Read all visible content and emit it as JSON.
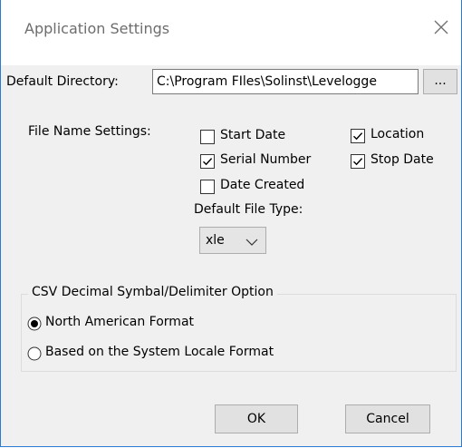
{
  "window": {
    "title": "Application Settings"
  },
  "directory": {
    "label": "Default Directory:",
    "value": "C:\\Program FIles\\Solinst\\Levelogge",
    "browse_label": "..."
  },
  "file_name_settings": {
    "label": "File Name Settings:",
    "options": [
      {
        "label": "Start Date",
        "checked": false
      },
      {
        "label": "Location",
        "checked": true
      },
      {
        "label": "Serial Number",
        "checked": true
      },
      {
        "label": "Stop Date",
        "checked": true
      },
      {
        "label": "Date Created",
        "checked": false
      }
    ]
  },
  "file_type": {
    "label": "Default File Type:",
    "selected": "xle"
  },
  "csv": {
    "group_label": "CSV Decimal Symbal/Delimiter Option",
    "options": [
      {
        "label": "North American Format",
        "selected": true
      },
      {
        "label": "Based on the System Locale Format",
        "selected": false
      }
    ]
  },
  "buttons": {
    "ok": "OK",
    "cancel": "Cancel"
  }
}
